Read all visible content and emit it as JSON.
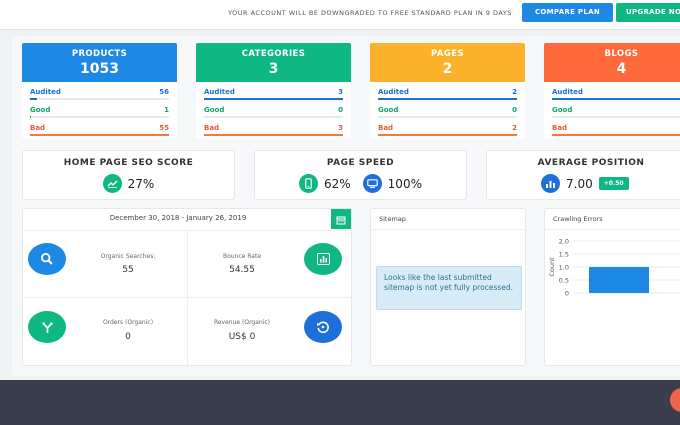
{
  "topbar": {
    "notice": "YOUR ACCOUNT WILL BE DOWNGRADED TO FREE STANDARD PLAN IN 9 DAYS",
    "compare_label": "COMPARE PLAN",
    "upgrade_label": "UPGRADE NO"
  },
  "stats": [
    {
      "title": "PRODUCTS",
      "value": "1053",
      "color": "#1e88e5",
      "rows": [
        {
          "label": "Audited",
          "value": "56",
          "fill": 0.05
        },
        {
          "label": "Good",
          "value": "1",
          "fill": 0.01
        },
        {
          "label": "Bad",
          "value": "55",
          "fill": 0.05
        }
      ]
    },
    {
      "title": "CATEGORIES",
      "value": "3",
      "color": "#0fb883",
      "rows": [
        {
          "label": "Audited",
          "value": "3",
          "fill": 1.0
        },
        {
          "label": "Good",
          "value": "0",
          "fill": 0
        },
        {
          "label": "Bad",
          "value": "3",
          "fill": 1.0
        }
      ]
    },
    {
      "title": "PAGES",
      "value": "2",
      "color": "#fbb12a",
      "rows": [
        {
          "label": "Audited",
          "value": "2",
          "fill": 1.0
        },
        {
          "label": "Good",
          "value": "0",
          "fill": 0
        },
        {
          "label": "Bad",
          "value": "2",
          "fill": 1.0
        }
      ]
    },
    {
      "title": "BLOGS",
      "value": "4",
      "color": "#ff6a3d",
      "rows": [
        {
          "label": "Audited",
          "value": "",
          "fill": 1.0
        },
        {
          "label": "Good",
          "value": "",
          "fill": 0
        },
        {
          "label": "Bad",
          "value": "",
          "fill": 1.0
        }
      ]
    }
  ],
  "scores": {
    "seo": {
      "title": "HOME PAGE SEO SCORE",
      "value": "27%",
      "icon": "line-chart-icon"
    },
    "speed": {
      "title": "PAGE SPEED",
      "mobile": "62%",
      "desktop": "100%"
    },
    "position": {
      "title": "AVERAGE POSITION",
      "value": "7.00",
      "change": "+0.50"
    }
  },
  "analytics": {
    "date_range": "December 30, 2018 - January 26, 2019",
    "organic_searches_label": "Organic Searches:",
    "organic_searches": "55",
    "bounce_rate_label": "Bounce Rate",
    "bounce_rate": "54.55",
    "orders_label": "Orders (Organic)",
    "orders": "0",
    "revenue_label": "Revenue (Organic)",
    "revenue": "US$ 0"
  },
  "sitemap": {
    "title": "Sitemap",
    "message": "Looks like the last submitted sitemap is not yet fully processed."
  },
  "crawling": {
    "title": "Crawling Errors"
  },
  "chart_data": {
    "type": "bar",
    "ylabel": "Count",
    "ylim": [
      0,
      2.0
    ],
    "yticks": [
      "2.0",
      "1.5",
      "1.0",
      "0.5",
      "0"
    ],
    "values": [
      1.0
    ]
  },
  "colors": {
    "blue": "#1e88e5",
    "green": "#0fb883",
    "orange": "#fbb12a",
    "red": "#ff6a3d"
  }
}
